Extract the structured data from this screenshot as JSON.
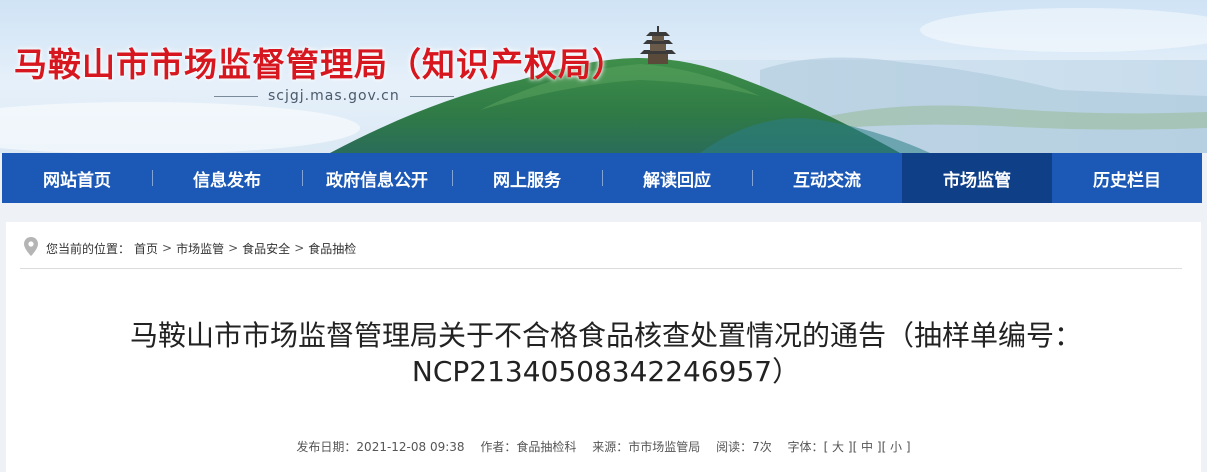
{
  "header": {
    "site_title": "马鞍山市市场监督管理局（知识产权局）",
    "site_domain": "scjgj.mas.gov.cn"
  },
  "nav": {
    "items": [
      {
        "label": "网站首页"
      },
      {
        "label": "信息发布"
      },
      {
        "label": "政府信息公开"
      },
      {
        "label": "网上服务"
      },
      {
        "label": "解读回应"
      },
      {
        "label": "互动交流"
      },
      {
        "label": "市场监管"
      },
      {
        "label": "历史栏目"
      }
    ],
    "active_index": 6
  },
  "breadcrumb": {
    "prefix": "您当前的位置：",
    "items": [
      "首页",
      "市场监管",
      "食品安全",
      "食品抽检"
    ],
    "separator": ">"
  },
  "article": {
    "title_line1": "马鞍山市市场监督管理局关于不合格食品核查处置情况的通告（抽样单编号：",
    "title_line2": "NCP21340508342246957）"
  },
  "meta": {
    "published": "发布日期：2021-12-08 09:38",
    "author": "作者：食品抽检科",
    "source": "来源：市市场监管局",
    "views": "阅读：7次",
    "font_label": "字体：",
    "font_large": "[ 大 ]",
    "font_medium": "[ 中 ]",
    "font_small": "[ 小 ]"
  },
  "colors": {
    "title_red": "#d7171f",
    "nav_blue": "#1c59b6",
    "nav_active": "#0f3f87"
  }
}
